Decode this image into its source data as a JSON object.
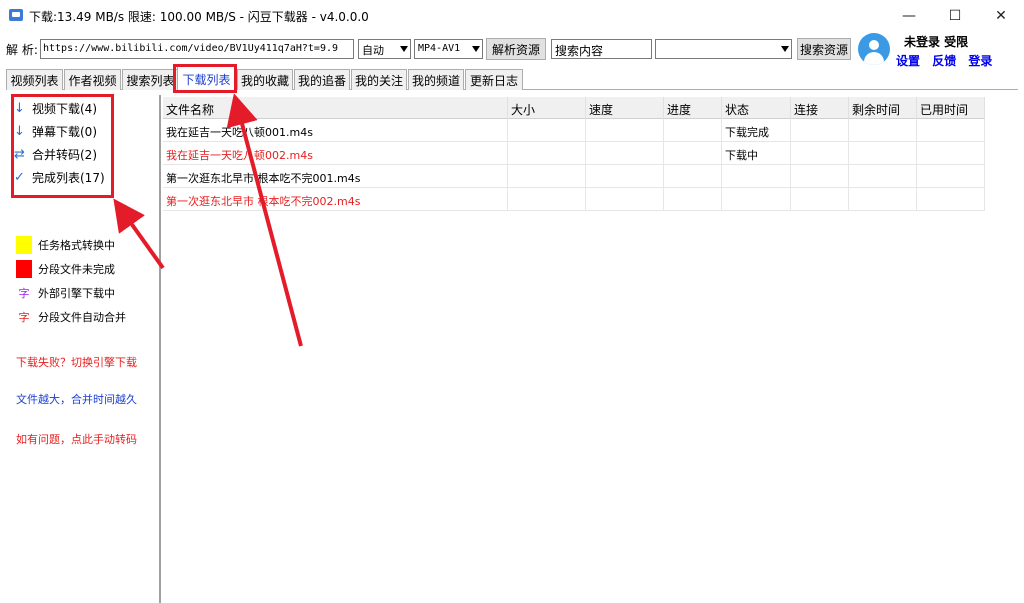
{
  "window": {
    "title": "下载:13.49 MB/s  限速: 100.00 MB/S  - 闪豆下载器 - v4.0.0.0",
    "minimize": "—",
    "maximize": "☐",
    "close": "✕"
  },
  "toolbar": {
    "parse_label": "解 析:",
    "url_value": "https://www.bilibili.com/video/BV1Uy411q7aH?t=9.9",
    "quality_select": "自动",
    "format_select": "MP4-AV1",
    "parse_button": "解析资源",
    "search_value": "搜索内容",
    "search_select": "",
    "search_button": "搜索资源"
  },
  "user": {
    "status": "未登录  受限",
    "links": [
      "设置",
      "反馈",
      "登录"
    ]
  },
  "tabs": [
    {
      "label": "视频列表",
      "active": false
    },
    {
      "label": "作者视频",
      "active": false
    },
    {
      "label": "搜索列表",
      "active": false
    },
    {
      "label": "下载列表",
      "active": true
    },
    {
      "label": "我的收藏",
      "active": false
    },
    {
      "label": "我的追番",
      "active": false
    },
    {
      "label": "我的关注",
      "active": false
    },
    {
      "label": "我的频道",
      "active": false
    },
    {
      "label": "更新日志",
      "active": false
    }
  ],
  "sidebar": {
    "nav": [
      {
        "icon": "↓",
        "label": "视频下载(4)"
      },
      {
        "icon": "↓",
        "label": "弹幕下载(0)"
      },
      {
        "icon": "⇄",
        "label": "合并转码(2)"
      },
      {
        "icon": "✓",
        "label": "完成列表(17)"
      }
    ],
    "legend": [
      {
        "label": "任务格式转换中",
        "color": "#ffff00"
      },
      {
        "label": "分段文件未完成",
        "color": "#ff0000"
      },
      {
        "glyph": "字",
        "label": "外部引擎下载中",
        "color": "#a020f0"
      },
      {
        "glyph": "字",
        "label": "分段文件自动合并",
        "color": "#e81e1e"
      }
    ],
    "tips": [
      {
        "text": "下载失败？切换引擎下载",
        "color": "#e81e1e"
      },
      {
        "text": "文件越大，合并时间越久",
        "color": "#1a3fd0"
      },
      {
        "text": "如有问题，点此手动转码",
        "color": "#e81e1e"
      }
    ]
  },
  "table": {
    "columns": [
      "文件名称",
      "大小",
      "速度",
      "进度",
      "状态",
      "连接",
      "剩余时间",
      "已用时间"
    ],
    "rows": [
      {
        "name": "我在延吉一天吃八顿001.m4s",
        "size": "",
        "speed": "",
        "progress": "",
        "status": "下载完成",
        "conn": "",
        "remaining": "",
        "elapsed": "",
        "color": "#000000"
      },
      {
        "name": "我在延吉一天吃八顿002.m4s",
        "size": "",
        "speed": "",
        "progress": "",
        "status": "下载中",
        "conn": "",
        "remaining": "",
        "elapsed": "",
        "color": "#e81e1e"
      },
      {
        "name": "第一次逛东北早市 根本吃不完001.m4s",
        "size": "",
        "speed": "",
        "progress": "",
        "status": "",
        "conn": "",
        "remaining": "",
        "elapsed": "",
        "color": "#000000"
      },
      {
        "name": "第一次逛东北早市 根本吃不完002.m4s",
        "size": "",
        "speed": "",
        "progress": "",
        "status": "",
        "conn": "",
        "remaining": "",
        "elapsed": "",
        "color": "#e81e1e"
      }
    ]
  },
  "colors": {
    "annotation_red": "#e41c2a",
    "link_blue": "#0000ee",
    "accent_blue": "#2a6fd0"
  }
}
